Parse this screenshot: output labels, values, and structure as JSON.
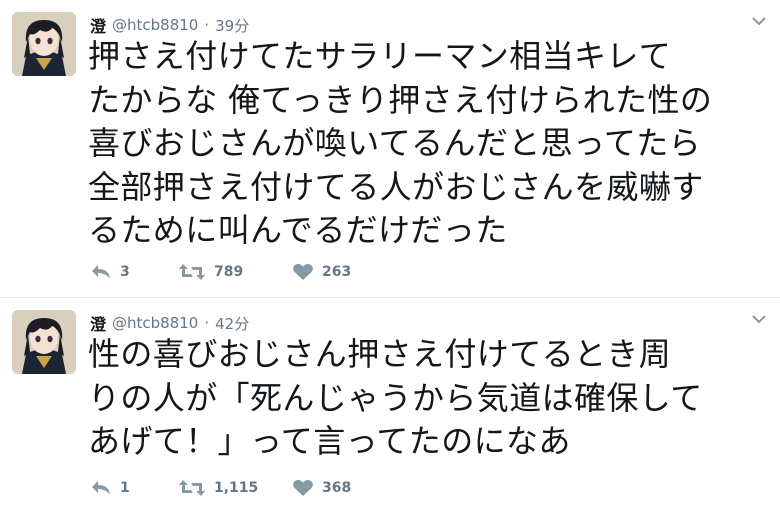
{
  "tweets": [
    {
      "name": "澄",
      "handle": "@htcb8810",
      "separator": "·",
      "time": "39分",
      "lines": [
        "押さえ付けてたサラリーマン相当キレて",
        "たからな 俺てっきり押さえ付けられた性の",
        "喜びおじさんが喚いてるんだと思ってたら",
        "全部押さえ付けてる人がおじさんを威嚇す",
        "るために叫んでるだけだった"
      ],
      "actions": {
        "replies": "3",
        "retweets": "789",
        "likes": "263"
      }
    },
    {
      "name": "澄",
      "handle": "@htcb8810",
      "separator": "·",
      "time": "42分",
      "lines": [
        "性の喜びおじさん押さえ付けてるとき周",
        "りの人が「死んじゃうから気道は確保して",
        "あげて！」って言ってたのになあ"
      ],
      "actions": {
        "replies": "1",
        "retweets": "1,115",
        "likes": "368"
      }
    }
  ],
  "colors": {
    "text": "#14171a",
    "muted": "#657786",
    "border": "#e6ecf0"
  },
  "icons": {
    "reply": "reply-icon",
    "retweet": "retweet-icon",
    "like": "heart-icon",
    "menu": "chevron-down-icon"
  }
}
